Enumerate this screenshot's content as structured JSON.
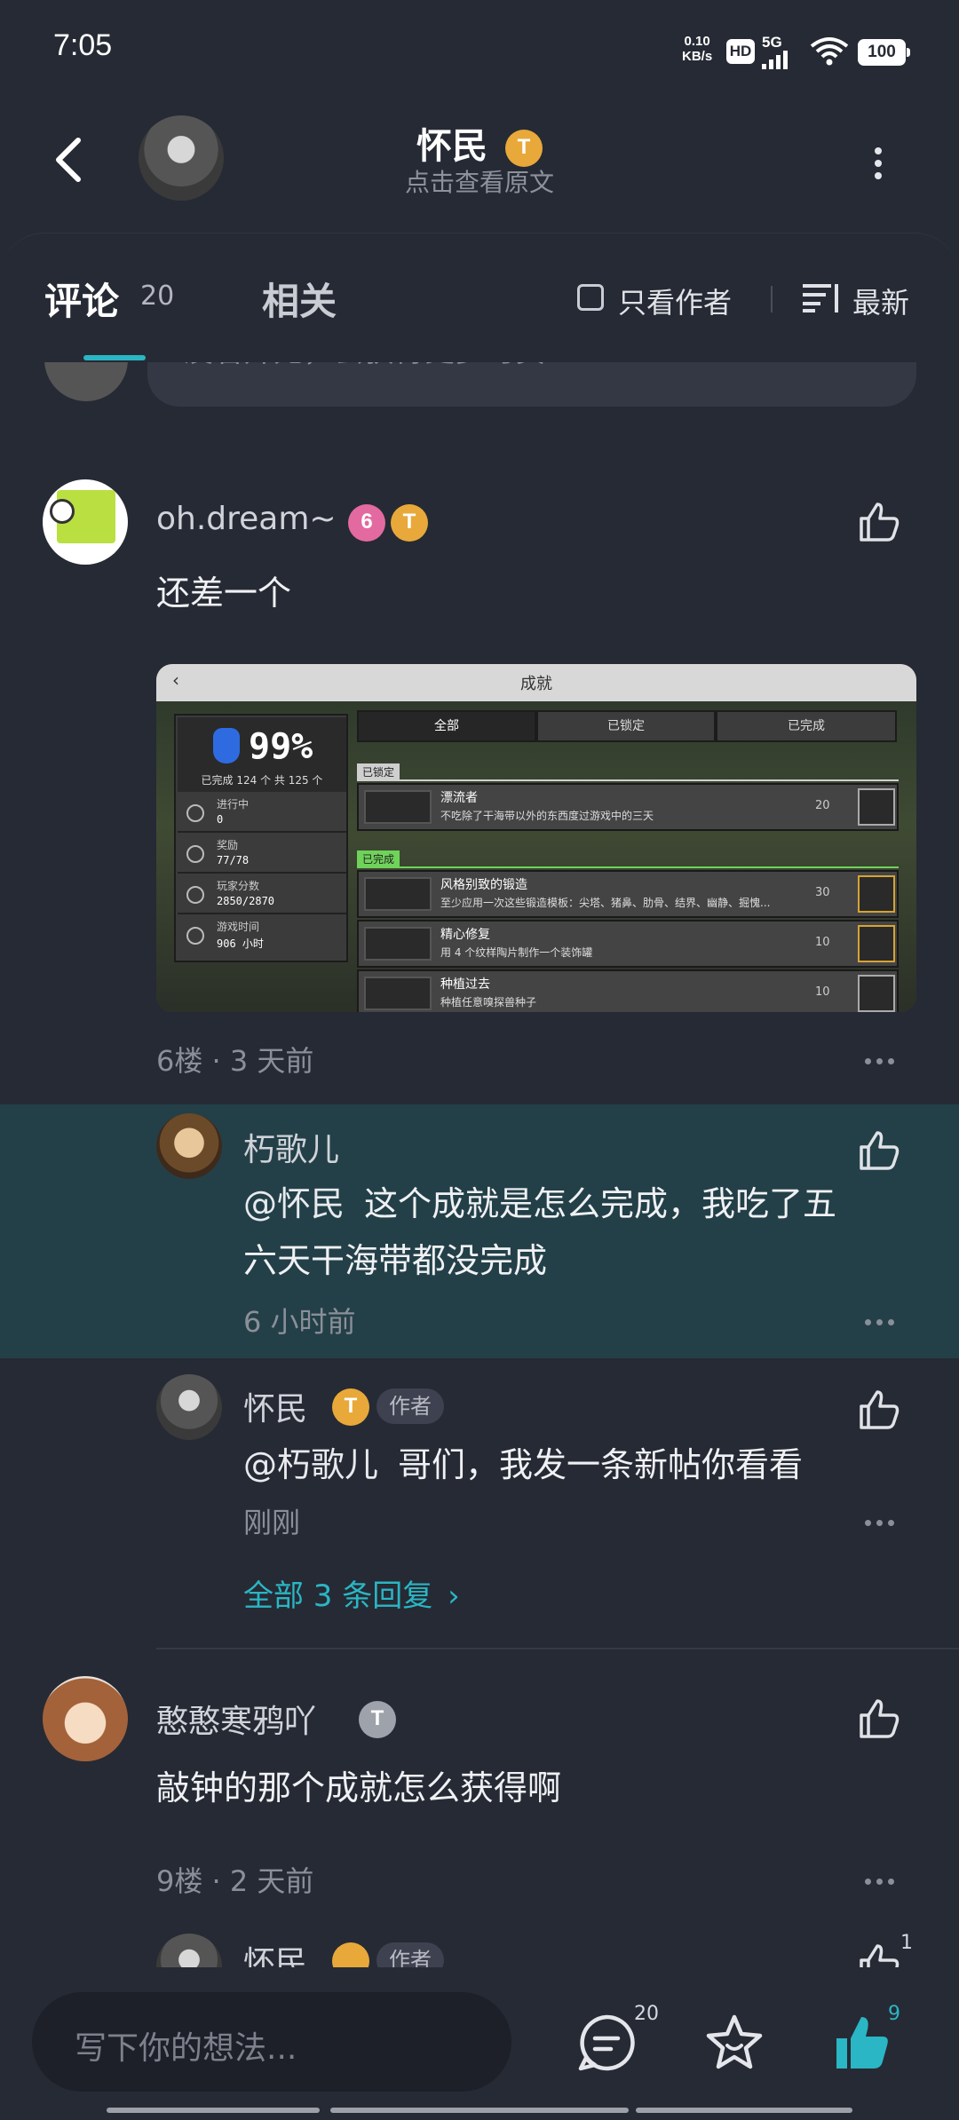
{
  "status_bar": {
    "time": "7:05",
    "net_speed": "0.10",
    "net_unit": "KB/s",
    "hd": "HD",
    "signal": "5G",
    "battery": "100"
  },
  "header": {
    "title": "怀民",
    "level_badge": "T",
    "subtitle": "点击查看原文"
  },
  "tabs": {
    "comments_label": "评论",
    "comments_count": "20",
    "related_label": "相关",
    "only_author_label": "只看作者",
    "sort_label": "最新"
  },
  "previous_comment": {
    "partial_text": "没看开无，会获得更多时员"
  },
  "comments": [
    {
      "name": "oh.dream~",
      "badges": [
        "6",
        "T"
      ],
      "text": "还差一个",
      "floor_meta": "6楼 · 3 天前",
      "screenshot": {
        "title": "成就",
        "percent": "99%",
        "summary": "已完成 124 个 共 125 个",
        "stats": [
          {
            "label": "进行中",
            "value": "0"
          },
          {
            "label": "奖励",
            "value": "77/78"
          },
          {
            "label": "玩家分数",
            "value": "2850/2870"
          },
          {
            "label": "游戏时间",
            "value": "906 小时"
          }
        ],
        "tabs": [
          "全部",
          "已锁定",
          "已完成"
        ],
        "group_locked": "已锁定",
        "group_done": "已完成",
        "rows": [
          {
            "title": "漂流者",
            "desc": "不吃除了干海带以外的东西度过游戏中的三天",
            "points": "20"
          },
          {
            "title": "风格别致的锻造",
            "desc": "至少应用一次这些锻造模板：尖塔、猪鼻、肋骨、结界、幽静、掘愧...",
            "points": "30"
          },
          {
            "title": "精心修复",
            "desc": "用 4 个纹样陶片制作一个装饰罐",
            "points": "10"
          },
          {
            "title": "种植过去",
            "desc": "种植任意嗅探兽种子",
            "points": "10"
          }
        ]
      }
    }
  ],
  "replies": [
    {
      "name": "朽歌儿",
      "mention": "@怀民",
      "text": "这个成就是怎么完成，我吃了五六天干海带都没完成",
      "line1": "这个成就是怎么完成，我吃了五",
      "line2": "六天干海带都没完成",
      "time": "6 小时前"
    },
    {
      "name": "怀民",
      "badge": "T",
      "author_tag": "作者",
      "mention": "@朽歌儿",
      "text": "哥们，我发一条新帖你看看",
      "time": "刚刚"
    }
  ],
  "all_replies_link": "全部 3 条回复",
  "comment2": {
    "name": "憨憨寒鸦吖",
    "badge": "T",
    "text": "敲钟的那个成就怎么获得啊",
    "floor_meta": "9楼 · 2 天前"
  },
  "partial_reply": {
    "name": "怀民",
    "author_tag": "作者",
    "like_count": "1"
  },
  "bottom_bar": {
    "input_placeholder": "写下你的想法...",
    "comment_count": "20",
    "like_count": "9"
  },
  "colors": {
    "background": "#262a34",
    "accent": "#2ab6c4",
    "highlight": "#234048",
    "badge_gold": "#e8a93a",
    "badge_pink": "#e36aa0"
  }
}
